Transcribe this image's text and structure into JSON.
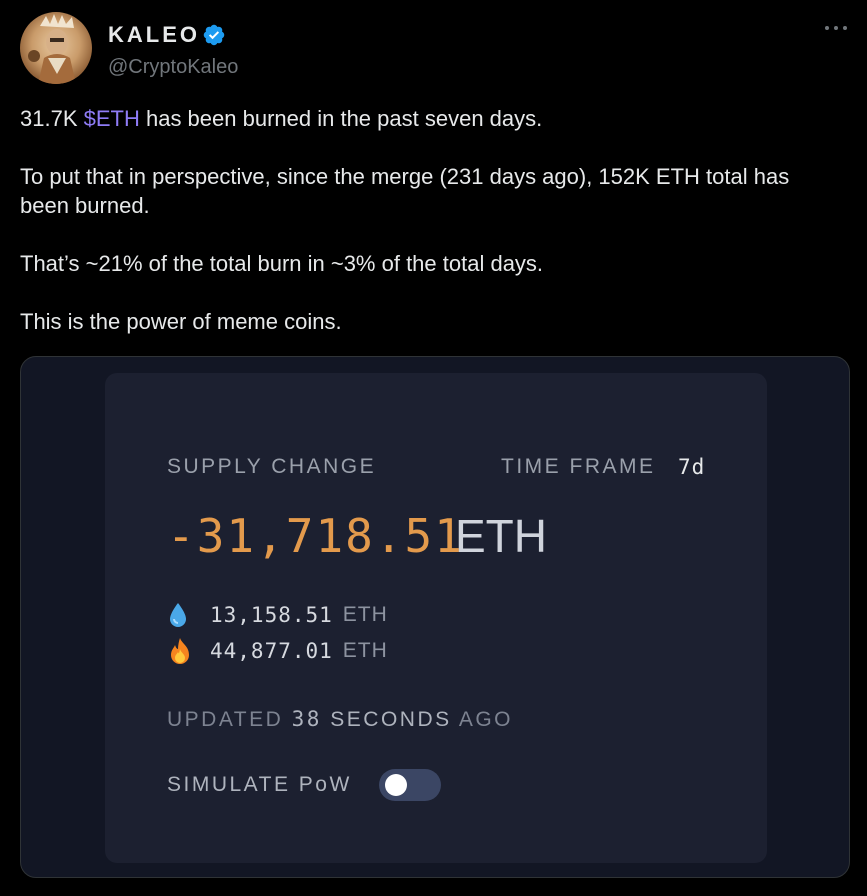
{
  "tweet": {
    "display_name": "KALEO",
    "handle": "@CryptoKaleo",
    "verified_icon": "verified-badge-icon",
    "more_icon": "more-options-icon",
    "text": {
      "line1_before": "31.7K ",
      "line1_cashtag": "$ETH",
      "line1_after": " has been burned in the past seven days.",
      "paragraph2": "To put that in perspective, since the merge (231 days ago), 152K ETH total has been burned.",
      "paragraph3": "That’s ~21% of the total burn in ~3% of the total days.",
      "paragraph4": "This is the power of meme coins."
    }
  },
  "card": {
    "supply_label": "SUPPLY CHANGE",
    "time_frame_label": "TIME FRAME",
    "time_frame_value": "7d",
    "supply_value": "-31,718.51",
    "supply_unit": "ETH",
    "issued": {
      "icon": "water-drop-icon",
      "value": "13,158.51",
      "unit": "ETH"
    },
    "burned": {
      "icon": "fire-icon",
      "value": "44,877.01",
      "unit": "ETH"
    },
    "updated": {
      "prefix": "UPDATED",
      "number": "38",
      "seconds": "SECONDS",
      "suffix": "AGO"
    },
    "simulate_label": "SIMULATE PoW",
    "simulate_pow_on": false
  },
  "colors": {
    "accent_cashtag": "#8f7cf6",
    "supply_value": "#e39a4c",
    "verified": "#1d9bf0"
  }
}
